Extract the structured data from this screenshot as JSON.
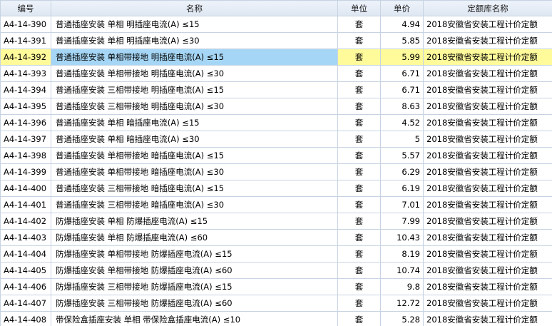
{
  "table": {
    "headers": [
      "编号",
      "名称",
      "单位",
      "单价",
      "定额库名称"
    ],
    "selected_index": 2,
    "rows": [
      {
        "code": "A4-14-390",
        "name": "普通插座安装 单相 明插座电流(A) ≤15",
        "unit": "套",
        "price": "4.94",
        "lib": "2018安徽省安装工程计价定额"
      },
      {
        "code": "A4-14-391",
        "name": "普通插座安装 单相 明插座电流(A) ≤30",
        "unit": "套",
        "price": "5.85",
        "lib": "2018安徽省安装工程计价定额"
      },
      {
        "code": "A4-14-392",
        "name": "普通插座安装 单相带接地 明插座电流(A) ≤15",
        "unit": "套",
        "price": "5.99",
        "lib": "2018安徽省安装工程计价定额"
      },
      {
        "code": "A4-14-393",
        "name": "普通插座安装 单相带接地 明插座电流(A) ≤30",
        "unit": "套",
        "price": "6.71",
        "lib": "2018安徽省安装工程计价定额"
      },
      {
        "code": "A4-14-394",
        "name": "普通插座安装 三相带接地 明插座电流(A) ≤15",
        "unit": "套",
        "price": "6.71",
        "lib": "2018安徽省安装工程计价定额"
      },
      {
        "code": "A4-14-395",
        "name": "普通插座安装 三相带接地 明插座电流(A) ≤30",
        "unit": "套",
        "price": "8.63",
        "lib": "2018安徽省安装工程计价定额"
      },
      {
        "code": "A4-14-396",
        "name": "普通插座安装 单相 暗插座电流(A) ≤15",
        "unit": "套",
        "price": "4.52",
        "lib": "2018安徽省安装工程计价定额"
      },
      {
        "code": "A4-14-397",
        "name": "普通插座安装 单相 暗插座电流(A) ≤30",
        "unit": "套",
        "price": "5",
        "lib": "2018安徽省安装工程计价定额"
      },
      {
        "code": "A4-14-398",
        "name": "普通插座安装 单相带接地 暗插座电流(A) ≤15",
        "unit": "套",
        "price": "5.57",
        "lib": "2018安徽省安装工程计价定额"
      },
      {
        "code": "A4-14-399",
        "name": "普通插座安装 单相带接地 暗插座电流(A) ≤30",
        "unit": "套",
        "price": "6.29",
        "lib": "2018安徽省安装工程计价定额"
      },
      {
        "code": "A4-14-400",
        "name": "普通插座安装 三相带接地 暗插座电流(A) ≤15",
        "unit": "套",
        "price": "6.19",
        "lib": "2018安徽省安装工程计价定额"
      },
      {
        "code": "A4-14-401",
        "name": "普通插座安装 三相带接地 暗插座电流(A) ≤30",
        "unit": "套",
        "price": "7.01",
        "lib": "2018安徽省安装工程计价定额"
      },
      {
        "code": "A4-14-402",
        "name": "防爆插座安装 单相 防爆插座电流(A) ≤15",
        "unit": "套",
        "price": "7.99",
        "lib": "2018安徽省安装工程计价定额"
      },
      {
        "code": "A4-14-403",
        "name": "防爆插座安装 单相 防爆插座电流(A) ≤60",
        "unit": "套",
        "price": "10.43",
        "lib": "2018安徽省安装工程计价定额"
      },
      {
        "code": "A4-14-404",
        "name": "防爆插座安装 单相带接地 防爆插座电流(A) ≤15",
        "unit": "套",
        "price": "8.19",
        "lib": "2018安徽省安装工程计价定额"
      },
      {
        "code": "A4-14-405",
        "name": "防爆插座安装 单相带接地 防爆插座电流(A) ≤60",
        "unit": "套",
        "price": "10.74",
        "lib": "2018安徽省安装工程计价定额"
      },
      {
        "code": "A4-14-406",
        "name": "防爆插座安装 三相带接地 防爆插座电流(A) ≤15",
        "unit": "套",
        "price": "9.8",
        "lib": "2018安徽省安装工程计价定额"
      },
      {
        "code": "A4-14-407",
        "name": "防爆插座安装 三相带接地 防爆插座电流(A) ≤60",
        "unit": "套",
        "price": "12.72",
        "lib": "2018安徽省安装工程计价定额"
      },
      {
        "code": "A4-14-408",
        "name": "带保险盒插座安装 单相 带保险盒插座电流(A) ≤10",
        "unit": "套",
        "price": "5.28",
        "lib": "2018安徽省安装工程计价定额"
      }
    ]
  }
}
